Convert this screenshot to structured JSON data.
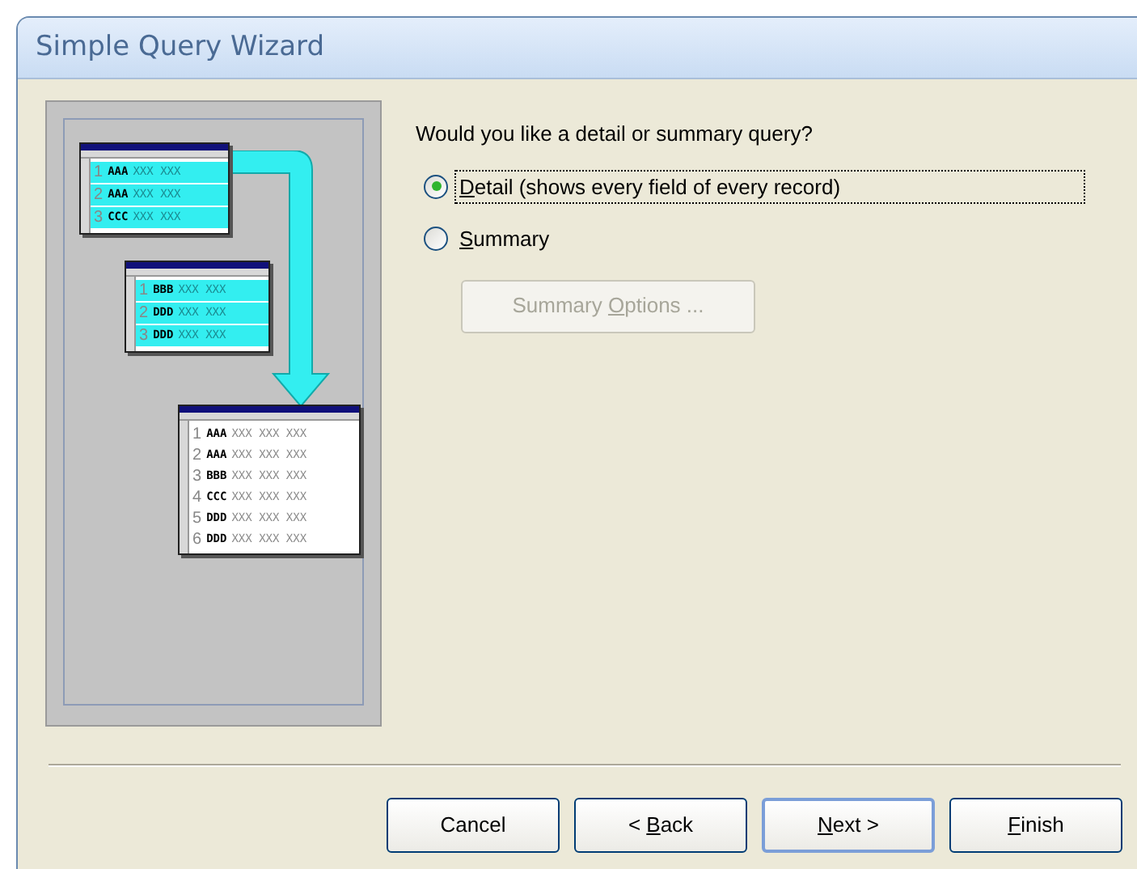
{
  "window": {
    "title": "Simple Query Wizard"
  },
  "illustration": {
    "source_tables": [
      {
        "rows": [
          {
            "number": "1",
            "key": "AAA",
            "values": "XXX XXX"
          },
          {
            "number": "2",
            "key": "AAA",
            "values": "XXX XXX"
          },
          {
            "number": "3",
            "key": "CCC",
            "values": "XXX XXX"
          }
        ]
      },
      {
        "rows": [
          {
            "number": "1",
            "key": "BBB",
            "values": "XXX XXX"
          },
          {
            "number": "2",
            "key": "DDD",
            "values": "XXX XXX"
          },
          {
            "number": "3",
            "key": "DDD",
            "values": "XXX XXX"
          }
        ]
      }
    ],
    "result_table": {
      "rows": [
        {
          "number": "1",
          "key": "AAA",
          "values": "XXX XXX XXX"
        },
        {
          "number": "2",
          "key": "AAA",
          "values": "XXX XXX XXX"
        },
        {
          "number": "3",
          "key": "BBB",
          "values": "XXX XXX XXX"
        },
        {
          "number": "4",
          "key": "CCC",
          "values": "XXX XXX XXX"
        },
        {
          "number": "5",
          "key": "DDD",
          "values": "XXX XXX XXX"
        },
        {
          "number": "6",
          "key": "DDD",
          "values": "XXX XXX XXX"
        }
      ]
    }
  },
  "prompt": "Would you like a detail or summary query?",
  "options": [
    {
      "label_parts": [
        {
          "text": "D",
          "underlined": true
        },
        {
          "text": "etail (shows every field of every record)",
          "underlined": false
        }
      ],
      "selected": true,
      "focused": true
    },
    {
      "label_parts": [
        {
          "text": "S",
          "underlined": true
        },
        {
          "text": "ummary",
          "underlined": false
        }
      ],
      "selected": false,
      "focused": false
    }
  ],
  "summary_options_button": {
    "label_parts": [
      {
        "text": "Summary ",
        "underlined": false
      },
      {
        "text": "O",
        "underlined": true
      },
      {
        "text": "ptions ...",
        "underlined": false
      }
    ],
    "disabled": true
  },
  "buttons": [
    {
      "label_parts": [
        {
          "text": "Cancel",
          "underlined": false
        }
      ],
      "default": false
    },
    {
      "label_parts": [
        {
          "text": "< ",
          "underlined": false
        },
        {
          "text": "B",
          "underlined": true
        },
        {
          "text": "ack",
          "underlined": false
        }
      ],
      "default": false
    },
    {
      "label_parts": [
        {
          "text": "N",
          "underlined": true
        },
        {
          "text": "ext >",
          "underlined": false
        }
      ],
      "default": true
    },
    {
      "label_parts": [
        {
          "text": "F",
          "underlined": true
        },
        {
          "text": "inish",
          "underlined": false
        }
      ],
      "default": false
    }
  ]
}
